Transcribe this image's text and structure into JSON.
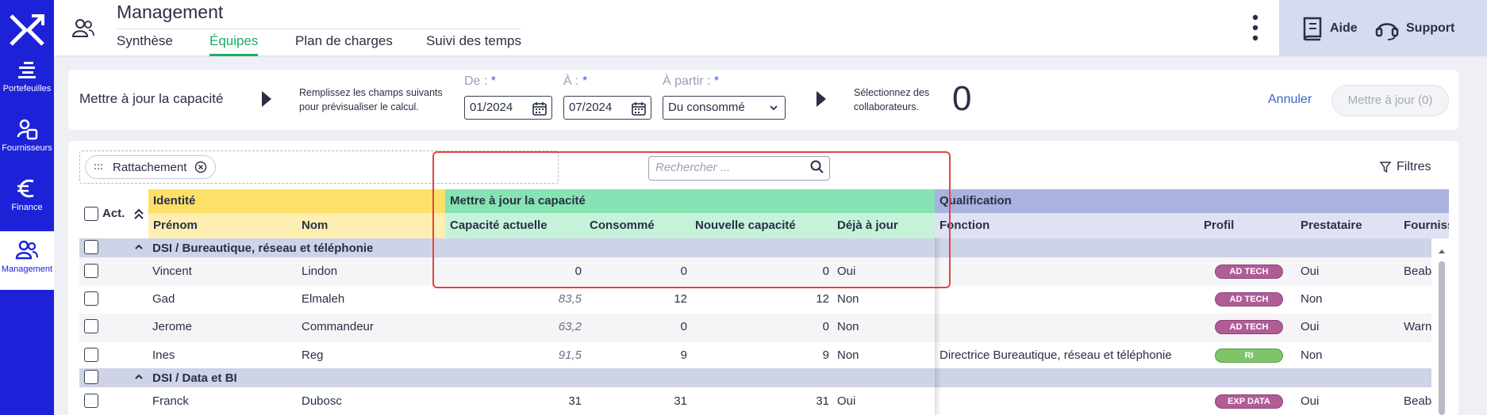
{
  "sidebar": {
    "items": [
      {
        "label": "Portefeuilles",
        "icon": "portfolio-icon"
      },
      {
        "label": "Fournisseurs",
        "icon": "supplier-icon"
      },
      {
        "label": "Finance",
        "icon": "euro-icon"
      },
      {
        "label": "Management",
        "icon": "users-icon",
        "active": true
      }
    ]
  },
  "header": {
    "title": "Management",
    "tabs": [
      "Synthèse",
      "Équipes",
      "Plan de charges",
      "Suivi des temps"
    ],
    "active_tab": "Équipes",
    "aide": "Aide",
    "support": "Support"
  },
  "capacity": {
    "title": "Mettre à jour la capacité",
    "hint1": "Remplissez les champs suivants",
    "hint2": "pour prévisualiser le calcul.",
    "de_label": "De :",
    "de_value": "01/2024",
    "a_label": "À :",
    "a_value": "07/2024",
    "apartir_label": "À partir :",
    "apartir_value": "Du consommé",
    "required": "*",
    "select_hint1": "Sélectionnez des",
    "select_hint2": "collaborateurs.",
    "count": "0",
    "annuler": "Annuler",
    "maj_button": "Mettre à jour (0)"
  },
  "table": {
    "group_chip": "Rattachement",
    "search_placeholder": "Rechercher ...",
    "filtres": "Filtres",
    "act_label": "Act.",
    "bands": {
      "identite": "Identité",
      "maj": "Mettre à jour la capacité",
      "qualification": "Qualification"
    },
    "columns": {
      "prenom": "Prénom",
      "nom": "Nom",
      "capacite": "Capacité actuelle",
      "consomme": "Consommé",
      "nouvelle": "Nouvelle capacité",
      "deja": "Déjà à jour",
      "fonction": "Fonction",
      "profil": "Profil",
      "prestataire": "Prestataire",
      "fournisseur": "Fourniss"
    },
    "groups": [
      {
        "name": "DSI / Bureautique, réseau et téléphonie"
      },
      {
        "name": "DSI / Data et BI"
      }
    ],
    "rows": [
      {
        "prenom": "Vincent",
        "nom": "Lindon",
        "capacite": "0",
        "capacite_italic": false,
        "consomme": "0",
        "nouvelle": "0",
        "deja": "Oui",
        "fonction": "",
        "profil": "AD TECH",
        "profil_color": "#b05c97",
        "prestataire": "Oui",
        "fournisseur": "Beaba"
      },
      {
        "prenom": "Gad",
        "nom": "Elmaleh",
        "capacite": "83,5",
        "capacite_italic": true,
        "consomme": "12",
        "nouvelle": "12",
        "deja": "Non",
        "fonction": "",
        "profil": "AD TECH",
        "profil_color": "#b05c97",
        "prestataire": "Non",
        "fournisseur": ""
      },
      {
        "prenom": "Jerome",
        "nom": "Commandeur",
        "capacite": "63,2",
        "capacite_italic": true,
        "consomme": "0",
        "nouvelle": "0",
        "deja": "Non",
        "fonction": "",
        "profil": "AD TECH",
        "profil_color": "#b05c97",
        "prestataire": "Oui",
        "fournisseur": "Warne"
      },
      {
        "prenom": "Ines",
        "nom": "Reg",
        "capacite": "91,5",
        "capacite_italic": true,
        "consomme": "9",
        "nouvelle": "9",
        "deja": "Non",
        "fonction": "Directrice Bureautique, réseau et téléphonie",
        "profil": "RI",
        "profil_color": "#7fc36a",
        "prestataire": "Non",
        "fournisseur": ""
      },
      {
        "prenom": "Franck",
        "nom": "Dubosc",
        "capacite": "31",
        "capacite_italic": false,
        "consomme": "31",
        "nouvelle": "31",
        "deja": "Oui",
        "fonction": "",
        "profil": "EXP DATA",
        "profil_color": "#b05c97",
        "prestataire": "Oui",
        "fournisseur": "Beaba"
      }
    ]
  },
  "colors": {
    "sidebar": "#1d22d9",
    "accent_green": "#1eaa6a",
    "band_identite": "#fde068",
    "band_maj": "#86e3b3",
    "band_qualif": "#aab2df",
    "highlight_box": "#e2453c"
  }
}
